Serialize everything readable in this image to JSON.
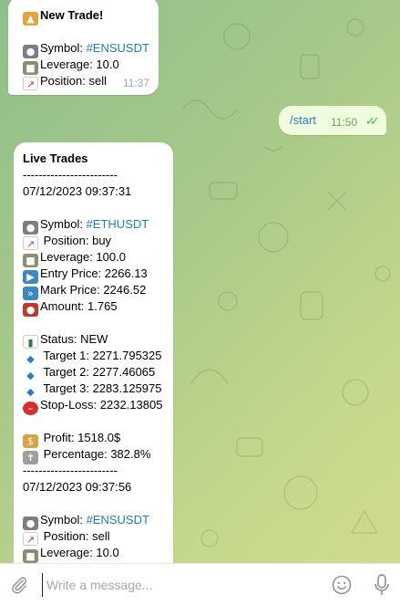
{
  "messages": {
    "new_trade": {
      "title": "New Trade!",
      "symbol_label": "Symbol: ",
      "symbol": "#ENSUSDT",
      "leverage": "Leverage: 10.0",
      "position": "Position: sell",
      "time": "11:37"
    },
    "start": {
      "text": "/start",
      "time": "11:50"
    },
    "live_trades": {
      "title": "Live Trades",
      "separator": "------------------------",
      "trade1": {
        "datetime": "07/12/2023 09:37:31",
        "symbol_label": "Symbol: ",
        "symbol": "#ETHUSDT",
        "position": " Position: buy",
        "leverage": "Leverage: 100.0",
        "entry": "Entry Price: 2266.13",
        "mark": "Mark Price: 2246.52",
        "amount": "Amount: 1.765",
        "status": "Status: NEW",
        "target1": " Target 1: 2271.795325",
        "target2": " Target 2: 2277.46065",
        "target3": " Target 3: 2283.125975",
        "stoploss": "Stop-Loss: 2232.13805",
        "profit": " Profit: 1518.0$",
        "percentage": " Percentage: 382.8%"
      },
      "trade2": {
        "datetime": "07/12/2023 09:37:56",
        "symbol_label": "Symbol: ",
        "symbol": "#ENSUSDT",
        "position": " Position: sell",
        "leverage": "Leverage: 10.0"
      }
    }
  },
  "composer": {
    "placeholder": "Write a message..."
  },
  "colors": {
    "hashtag": "#1f7bbd",
    "outgoing_bubble": "#effdde",
    "read_ticks": "#4fae4e"
  }
}
